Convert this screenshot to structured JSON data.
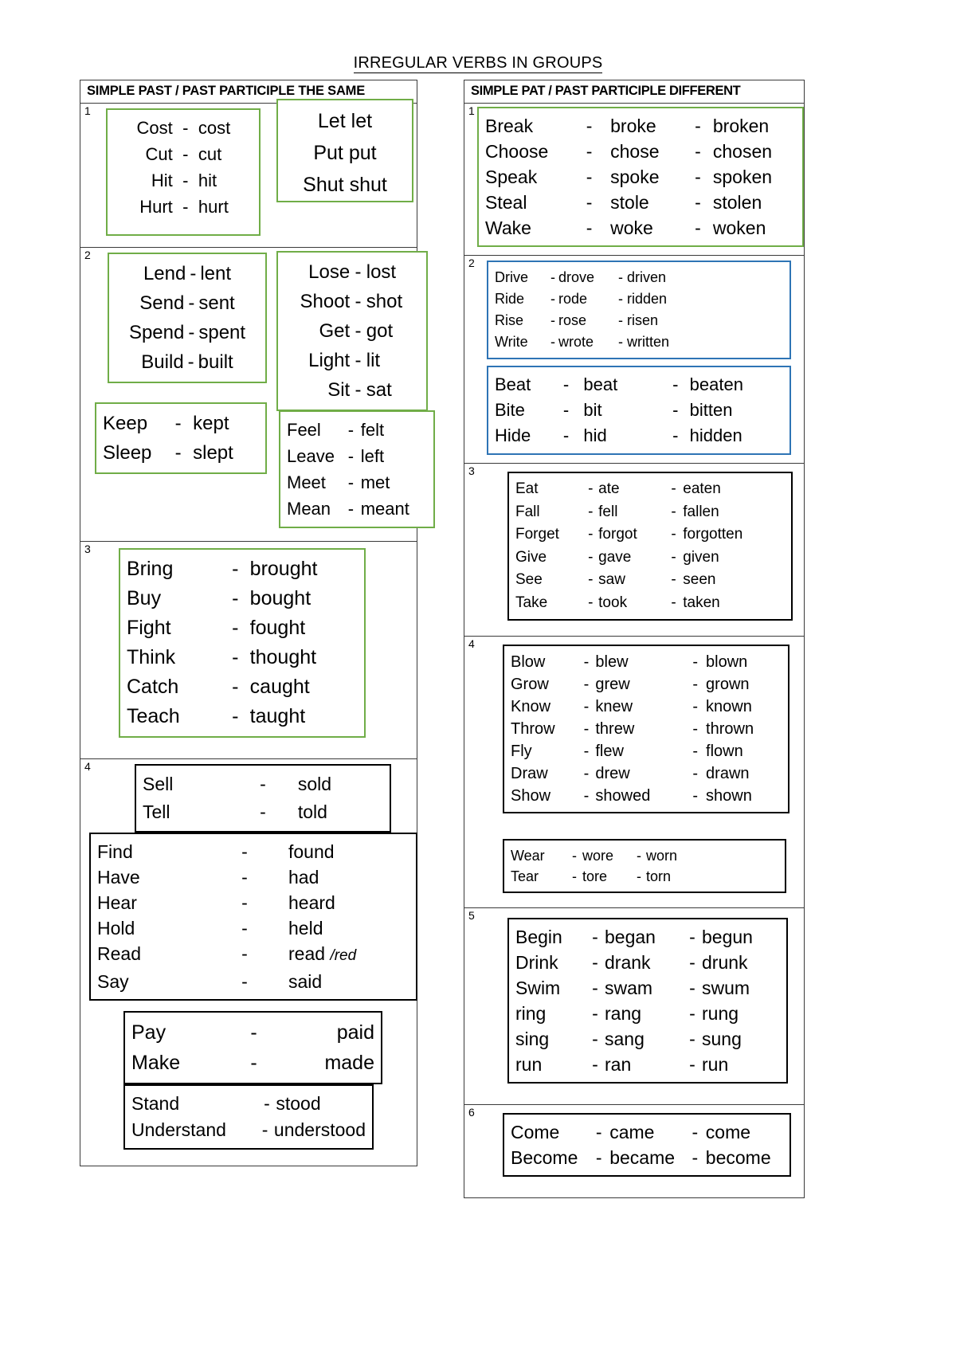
{
  "document": {
    "title": "IRREGULAR VERBS IN GROUPS"
  },
  "colors": {
    "green_border": "#70ad47",
    "blue_border": "#2e74b5",
    "black_border": "#000000",
    "table_border": "#3a3a3a",
    "text": "#000000"
  },
  "left_column": {
    "header": "SIMPLE PAST / PAST PARTICIPLE THE SAME",
    "groups": [
      {
        "number": "1",
        "boxes": [
          {
            "border": "green",
            "rows": [
              {
                "base": "Cost",
                "dash": "-",
                "past": "cost"
              },
              {
                "base": "Cut",
                "dash": "-",
                "past": "cut"
              },
              {
                "base": "Hit",
                "dash": "-",
                "past": "hit"
              },
              {
                "base": "Hurt",
                "dash": "-",
                "past": "hurt"
              }
            ]
          },
          {
            "border": "green",
            "rows": [
              {
                "base": "Let",
                "past": "let"
              },
              {
                "base": "Put",
                "past": "put"
              },
              {
                "base": "Shut",
                "past": "shut"
              }
            ]
          }
        ]
      },
      {
        "number": "2",
        "boxes": [
          {
            "border": "green",
            "rows": [
              {
                "base": "Lend",
                "dash": "-",
                "past": "lent"
              },
              {
                "base": "Send",
                "dash": "-",
                "past": "sent"
              },
              {
                "base": "Spend",
                "dash": "-",
                "past": "spent"
              },
              {
                "base": "Build",
                "dash": "-",
                "past": "built"
              }
            ]
          },
          {
            "border": "green",
            "rows": [
              {
                "base": "Lose",
                "dash": "-",
                "past": "lost"
              },
              {
                "base": "Shoot",
                "dash": "-",
                "past": "shot"
              },
              {
                "base": "Get",
                "dash": "-",
                "past": "got"
              },
              {
                "base": "Light",
                "dash": "-",
                "past": "lit"
              },
              {
                "base": "Sit",
                "dash": "-",
                "past": "sat"
              }
            ]
          },
          {
            "border": "green",
            "rows": [
              {
                "base": "Keep",
                "dash": "-",
                "past": "kept"
              },
              {
                "base": "Sleep",
                "dash": "-",
                "past": "slept"
              }
            ]
          },
          {
            "border": "green",
            "rows": [
              {
                "base": "Feel",
                "dash": "-",
                "past": "felt"
              },
              {
                "base": "Leave",
                "dash": "-",
                "past": "left"
              },
              {
                "base": "Meet",
                "dash": "-",
                "past": "met"
              },
              {
                "base": "Mean",
                "dash": "-",
                "past": "meant"
              }
            ]
          }
        ]
      },
      {
        "number": "3",
        "boxes": [
          {
            "border": "green",
            "rows": [
              {
                "base": "Bring",
                "dash": "-",
                "past": "brought"
              },
              {
                "base": "Buy",
                "dash": "-",
                "past": "bought"
              },
              {
                "base": "Fight",
                "dash": "-",
                "past": "fought"
              },
              {
                "base": "Think",
                "dash": "-",
                "past": "thought"
              },
              {
                "base": "Catch",
                "dash": "-",
                "past": "caught"
              },
              {
                "base": "Teach",
                "dash": "-",
                "past": "taught"
              }
            ]
          }
        ]
      },
      {
        "number": "4",
        "boxes": [
          {
            "border": "black",
            "rows": [
              {
                "base": "Sell",
                "dash": "-",
                "past": "sold"
              },
              {
                "base": "Tell",
                "dash": "-",
                "past": "told"
              }
            ]
          },
          {
            "border": "black",
            "rows": [
              {
                "base": "Find",
                "dash": "-",
                "past": "found"
              },
              {
                "base": "Have",
                "dash": "-",
                "past": "had"
              },
              {
                "base": "Hear",
                "dash": "-",
                "past": "heard"
              },
              {
                "base": "Hold",
                "dash": "-",
                "past": "held"
              },
              {
                "base": "Read",
                "dash": "-",
                "past": "read",
                "note": "/red"
              },
              {
                "base": "Say",
                "dash": "-",
                "past": "said"
              }
            ]
          },
          {
            "border": "black",
            "rows": [
              {
                "base": "Pay",
                "dash": "-",
                "past": "paid"
              },
              {
                "base": "Make",
                "dash": "-",
                "past": "made"
              }
            ]
          },
          {
            "border": "black",
            "rows": [
              {
                "base": "Stand",
                "dash": "-",
                "past": "stood"
              },
              {
                "base": "Understand",
                "dash": "-",
                "past": "understood"
              }
            ]
          }
        ]
      }
    ]
  },
  "right_column": {
    "header": "SIMPLE PAT / PAST PARTICIPLE DIFFERENT",
    "groups": [
      {
        "number": "1",
        "boxes": [
          {
            "border": "green",
            "rows": [
              {
                "base": "Break",
                "dash": "-",
                "past": "broke",
                "dash2": "-",
                "participle": "broken"
              },
              {
                "base": "Choose",
                "dash": "-",
                "past": "chose",
                "dash2": "-",
                "participle": "chosen"
              },
              {
                "base": "Speak",
                "dash": "-",
                "past": "spoke",
                "dash2": "-",
                "participle": "spoken"
              },
              {
                "base": "Steal",
                "dash": "-",
                "past": "stole",
                "dash2": "-",
                "participle": "stolen"
              },
              {
                "base": "Wake",
                "dash": "-",
                "past": "woke",
                "dash2": "-",
                "participle": "woken"
              }
            ]
          }
        ]
      },
      {
        "number": "2",
        "boxes": [
          {
            "border": "blue",
            "rows": [
              {
                "base": "Drive",
                "dash": "-",
                "past": "drove",
                "dash2": "-",
                "participle": "driven"
              },
              {
                "base": "Ride",
                "dash": "-",
                "past": "rode",
                "dash2": "-",
                "participle": "ridden"
              },
              {
                "base": "Rise",
                "dash": "-",
                "past": "rose",
                "dash2": "-",
                "participle": "risen"
              },
              {
                "base": "Write",
                "dash": "-",
                "past": "wrote",
                "dash2": "-",
                "participle": "written"
              }
            ]
          },
          {
            "border": "blue",
            "rows": [
              {
                "base": "Beat",
                "dash": "-",
                "past": "beat",
                "dash2": "-",
                "participle": "beaten"
              },
              {
                "base": "Bite",
                "dash": "-",
                "past": "bit",
                "dash2": "-",
                "participle": "bitten"
              },
              {
                "base": "Hide",
                "dash": "-",
                "past": "hid",
                "dash2": "-",
                "participle": "hidden"
              }
            ]
          }
        ]
      },
      {
        "number": "3",
        "boxes": [
          {
            "border": "black",
            "rows": [
              {
                "base": "Eat",
                "dash": "-",
                "past": "ate",
                "dash2": "-",
                "participle": "eaten"
              },
              {
                "base": "Fall",
                "dash": "-",
                "past": "fell",
                "dash2": "-",
                "participle": "fallen"
              },
              {
                "base": "Forget",
                "dash": "-",
                "past": "forgot",
                "dash2": "-",
                "participle": "forgotten"
              },
              {
                "base": "Give",
                "dash": "-",
                "past": "gave",
                "dash2": "-",
                "participle": "given"
              },
              {
                "base": "See",
                "dash": "-",
                "past": "saw",
                "dash2": "-",
                "participle": "seen"
              },
              {
                "base": "Take",
                "dash": "-",
                "past": "took",
                "dash2": "-",
                "participle": "taken"
              }
            ]
          }
        ]
      },
      {
        "number": "4",
        "boxes": [
          {
            "border": "black",
            "rows": [
              {
                "base": "Blow",
                "dash": "-",
                "past": "blew",
                "dash2": "-",
                "participle": "blown"
              },
              {
                "base": "Grow",
                "dash": "-",
                "past": "grew",
                "dash2": "-",
                "participle": "grown"
              },
              {
                "base": "Know",
                "dash": "-",
                "past": "knew",
                "dash2": "-",
                "participle": "known"
              },
              {
                "base": "Throw",
                "dash": "-",
                "past": "threw",
                "dash2": "-",
                "participle": "thrown"
              },
              {
                "base": "Fly",
                "dash": "-",
                "past": "flew",
                "dash2": "-",
                "participle": "flown"
              },
              {
                "base": "Draw",
                "dash": "-",
                "past": "drew",
                "dash2": "-",
                "participle": "drawn"
              },
              {
                "base": "Show",
                "dash": "-",
                "past": "showed",
                "dash2": "-",
                "participle": "shown"
              }
            ]
          },
          {
            "border": "black",
            "rows": [
              {
                "base": "Wear",
                "dash": "-",
                "past": "wore",
                "dash2": "-",
                "participle": "worn"
              },
              {
                "base": "Tear",
                "dash": "-",
                "past": "tore",
                "dash2": "-",
                "participle": "torn"
              }
            ]
          }
        ]
      },
      {
        "number": "5",
        "boxes": [
          {
            "border": "black",
            "rows": [
              {
                "base": "Begin",
                "dash": "-",
                "past": "began",
                "dash2": "-",
                "participle": "begun"
              },
              {
                "base": "Drink",
                "dash": "-",
                "past": "drank",
                "dash2": "-",
                "participle": "drunk"
              },
              {
                "base": "Swim",
                "dash": "-",
                "past": "swam",
                "dash2": "-",
                "participle": "swum"
              },
              {
                "base": "ring",
                "dash": "-",
                "past": "rang",
                "dash2": "-",
                "participle": "rung"
              },
              {
                "base": "sing",
                "dash": "-",
                "past": "sang",
                "dash2": "-",
                "participle": "sung"
              },
              {
                "base": "run",
                "dash": "-",
                "past": "ran",
                "dash2": "-",
                "participle": "run"
              }
            ]
          }
        ]
      },
      {
        "number": "6",
        "boxes": [
          {
            "border": "black",
            "rows": [
              {
                "base": "Come",
                "dash": "-",
                "past": "came",
                "dash2": "-",
                "participle": "come"
              },
              {
                "base": "Become",
                "dash": "-",
                "past": "became",
                "dash2": "-",
                "participle": "become"
              }
            ]
          }
        ]
      }
    ]
  }
}
